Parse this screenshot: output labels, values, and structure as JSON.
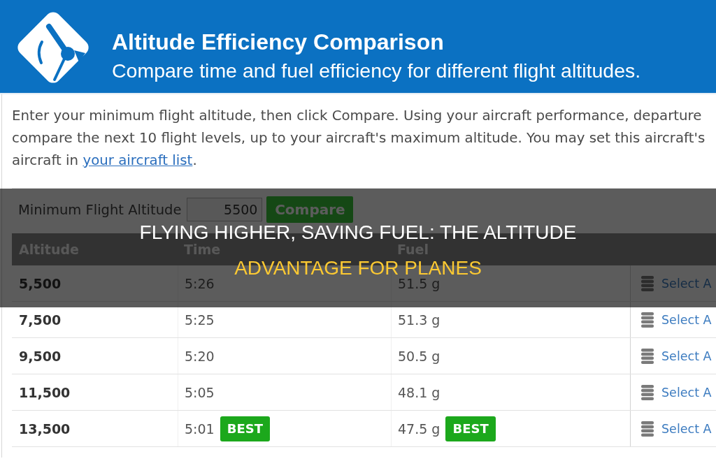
{
  "header": {
    "title": "Altitude Efficiency Comparison",
    "subtitle": "Compare time and fuel efficiency for different flight altitudes."
  },
  "intro": {
    "lines": [
      "Enter your minimum flight altitude, then click Compare. Using your aircraft performance, departure",
      "compare the next 10 flight levels, up to your aircraft's maximum altitude. You may set this aircraft's"
    ],
    "last_line": {
      "text": "aircraft in",
      "link": "your aircraft list",
      "end": "."
    }
  },
  "form": {
    "label": "Minimum Flight Altitude",
    "value": "5500",
    "button": "Compare"
  },
  "table": {
    "columns": [
      "Altitude",
      "Time",
      "Fuel"
    ],
    "rows": [
      {
        "altitude": "5,500",
        "time": "5:26",
        "fuel": "51.5 g",
        "column_4": "Select A"
      },
      {
        "altitude": "7,500",
        "time": "5:25",
        "fuel": "51.3 g",
        "column_4": "Select A"
      },
      {
        "altitude": "9,500",
        "time": "5:20",
        "fuel": "50.5 g",
        "column_4": "Select A"
      },
      {
        "altitude": "11,500",
        "time": "5:05",
        "fuel": "48.1 g",
        "column_4": "Select A"
      },
      {
        "altitude": "13,500",
        "time": "5:01",
        "time_badge": "BEST",
        "fuel": "47.5 g",
        "fuel_badge": "BEST",
        "column_4": "Select A"
      }
    ]
  },
  "title_banner": {
    "lines": [
      {
        "text": "FLYING HIGHER, SAVING FUEL: THE ALTITUDE",
        "highlighted": false
      },
      {
        "text": "ADVANTAGE FOR PLANES",
        "highlighted": true
      }
    ]
  }
}
